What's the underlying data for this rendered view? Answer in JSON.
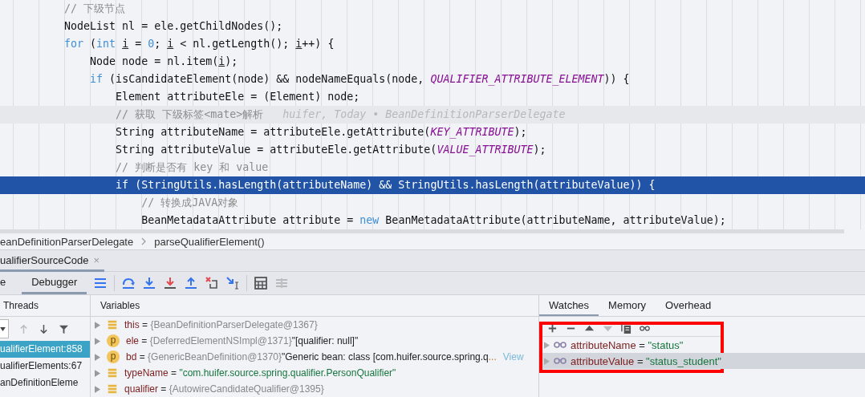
{
  "editor": {
    "lines": [
      {
        "execution_point": false,
        "caret_line": false,
        "tokens": [
          {
            "kind": "comment",
            "text": "            // 下级节点"
          }
        ]
      },
      {
        "execution_point": false,
        "caret_line": false,
        "tokens": [
          {
            "kind": "plain",
            "text": "            NodeList nl = ele.getChildNodes();"
          }
        ]
      },
      {
        "execution_point": false,
        "caret_line": false,
        "tokens": [
          {
            "kind": "keyword",
            "text": "            for"
          },
          {
            "kind": "plain",
            "text": " ("
          },
          {
            "kind": "keyword",
            "text": "int "
          },
          {
            "kind": "reassigned",
            "text": "i"
          },
          {
            "kind": "plain",
            "text": " = "
          },
          {
            "kind": "number",
            "text": "0"
          },
          {
            "kind": "plain",
            "text": "; "
          },
          {
            "kind": "reassigned",
            "text": "i"
          },
          {
            "kind": "plain",
            "text": " < nl.getLength(); "
          },
          {
            "kind": "reassigned",
            "text": "i"
          },
          {
            "kind": "plain",
            "text": "++) {"
          }
        ]
      },
      {
        "execution_point": false,
        "caret_line": false,
        "tokens": [
          {
            "kind": "plain",
            "text": "                Node node = nl.item("
          },
          {
            "kind": "reassigned",
            "text": "i"
          },
          {
            "kind": "plain",
            "text": ");"
          }
        ]
      },
      {
        "execution_point": false,
        "caret_line": false,
        "tokens": [
          {
            "kind": "keyword",
            "text": "                if"
          },
          {
            "kind": "plain",
            "text": " (isCandidateElement(node) && nodeNameEquals(node, "
          },
          {
            "kind": "constant",
            "text": "QUALIFIER_ATTRIBUTE_ELEMENT"
          },
          {
            "kind": "plain",
            "text": ")) {"
          }
        ]
      },
      {
        "execution_point": false,
        "caret_line": false,
        "tokens": [
          {
            "kind": "plain",
            "text": "                    Element attributeEle = (Element) node;"
          }
        ]
      },
      {
        "execution_point": false,
        "caret_line": true,
        "tokens": [
          {
            "kind": "comment",
            "text": "                    // 获取 下级标签<mate>解析"
          },
          {
            "kind": "hint",
            "text": "huifer, Today • BeanDefinitionParserDelegate"
          }
        ]
      },
      {
        "execution_point": false,
        "caret_line": false,
        "tokens": [
          {
            "kind": "plain",
            "text": "                    String attributeName = attributeEle.getAttribute("
          },
          {
            "kind": "constant",
            "text": "KEY_ATTRIBUTE"
          },
          {
            "kind": "plain",
            "text": ");"
          }
        ]
      },
      {
        "execution_point": false,
        "caret_line": false,
        "tokens": [
          {
            "kind": "plain",
            "text": "                    String attributeValue = attributeEle.getAttribute("
          },
          {
            "kind": "constant",
            "text": "VALUE_ATTRIBUTE"
          },
          {
            "kind": "plain",
            "text": ");"
          }
        ]
      },
      {
        "execution_point": false,
        "caret_line": false,
        "tokens": [
          {
            "kind": "comment",
            "text": "                    // 判断是否有 key 和 value"
          }
        ]
      },
      {
        "execution_point": true,
        "caret_line": false,
        "tokens": [
          {
            "kind": "keyword",
            "text": "                    if"
          },
          {
            "kind": "plain",
            "text": " (StringUtils.hasLength(attributeName) && StringUtils.hasLength(attributeValue)) {"
          }
        ]
      },
      {
        "execution_point": false,
        "caret_line": false,
        "tokens": [
          {
            "kind": "comment",
            "text": "                        // 转换成JAVA对象"
          }
        ]
      },
      {
        "execution_point": false,
        "caret_line": false,
        "tokens": [
          {
            "kind": "plain",
            "text": "                        BeanMetadataAttribute attribute = "
          },
          {
            "kind": "keyword",
            "text": "new"
          },
          {
            "kind": "plain",
            "text": " BeanMetadataAttribute(attributeName, attributeValue);"
          }
        ]
      }
    ]
  },
  "breadcrumb": [
    "eanDefinitionParserDelegate",
    "parseQualifierElement()"
  ],
  "run_tab": {
    "label": "ualifierSourceCode",
    "close": "×"
  },
  "debug_tabs": [
    {
      "label": "e",
      "selected": false
    },
    {
      "label": "Debugger",
      "selected": true
    }
  ],
  "threads": {
    "title": "Threads",
    "frames": [
      {
        "label": "ualifierElement:858",
        "selected": true
      },
      {
        "label": "ualifierElements:67",
        "selected": false
      },
      {
        "label": "anDefinitionEleme",
        "selected": false
      }
    ]
  },
  "variables": {
    "title": "Variables",
    "rows": [
      {
        "kind": "field",
        "name": "this",
        "assign": "=",
        "ref": "{BeanDefinitionParserDelegate@1367}"
      },
      {
        "kind": "param",
        "badge": "p",
        "name": "ele",
        "assign": "=",
        "ref": "{DeferredElementNSImpl@1371}",
        "summary": "\"[qualifier: null]\""
      },
      {
        "kind": "param",
        "badge": "p",
        "name": "bd",
        "assign": "=",
        "ref": "{GenericBeanDefinition@1370}",
        "summary": "\"Generic bean: class [com.huifer.source.spring.q",
        "ellipsis": "...",
        "link": "View"
      },
      {
        "kind": "field",
        "name": "typeName",
        "assign": "=",
        "string": "\"com.huifer.source.spring.qualifier.PersonQualifier\""
      },
      {
        "kind": "field",
        "name": "qualifier",
        "assign": "=",
        "ref": "{AutowireCandidateQualifier@1395}"
      }
    ]
  },
  "watch_tabs": [
    {
      "label": "Watches",
      "selected": true
    },
    {
      "label": "Memory",
      "selected": false
    },
    {
      "label": "Overhead",
      "selected": false
    }
  ],
  "watches": [
    {
      "name": "attributeName",
      "assign": "=",
      "value": "\"status\"",
      "selected": false
    },
    {
      "name": "attributeValue",
      "assign": "=",
      "value": "\"status_student\"",
      "selected": true
    }
  ]
}
